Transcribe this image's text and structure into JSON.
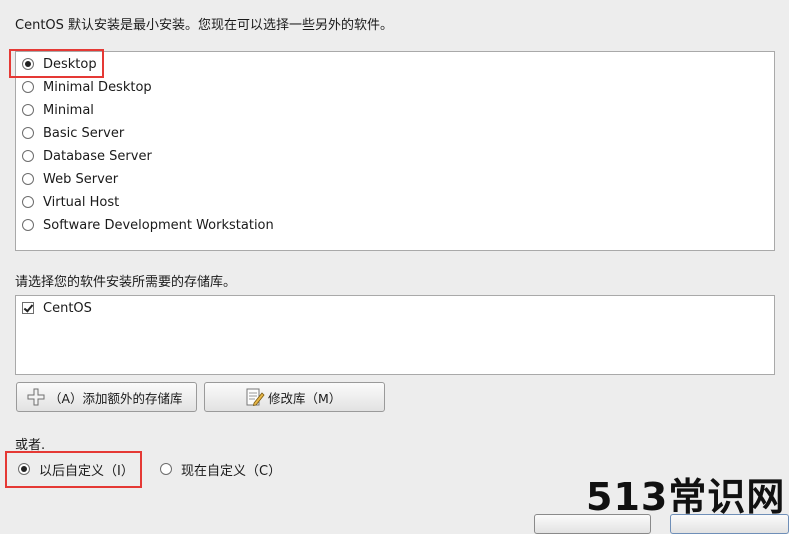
{
  "intro_text": "CentOS 默认安装是最小安装。您现在可以选择一些另外的软件。",
  "install_options": [
    {
      "label": "Desktop",
      "selected": true
    },
    {
      "label": "Minimal Desktop",
      "selected": false
    },
    {
      "label": "Minimal",
      "selected": false
    },
    {
      "label": "Basic Server",
      "selected": false
    },
    {
      "label": "Database Server",
      "selected": false
    },
    {
      "label": "Web Server",
      "selected": false
    },
    {
      "label": "Virtual Host",
      "selected": false
    },
    {
      "label": "Software Development Workstation",
      "selected": false
    }
  ],
  "repo_section_label": "请选择您的软件安装所需要的存储库。",
  "repos": [
    {
      "label": "CentOS",
      "checked": true
    }
  ],
  "buttons": {
    "add_repo": "（A）添加额外的存储库",
    "modify_repo": "修改库（M）"
  },
  "or_label": "或者.",
  "customize": {
    "later": "以后自定义（I）",
    "now": "现在自定义（C）",
    "selected": "later"
  },
  "watermark": "513常识网",
  "icons": {
    "add": "plus-icon",
    "modify": "edit-document-icon"
  },
  "colors": {
    "highlight": "#e53935"
  }
}
